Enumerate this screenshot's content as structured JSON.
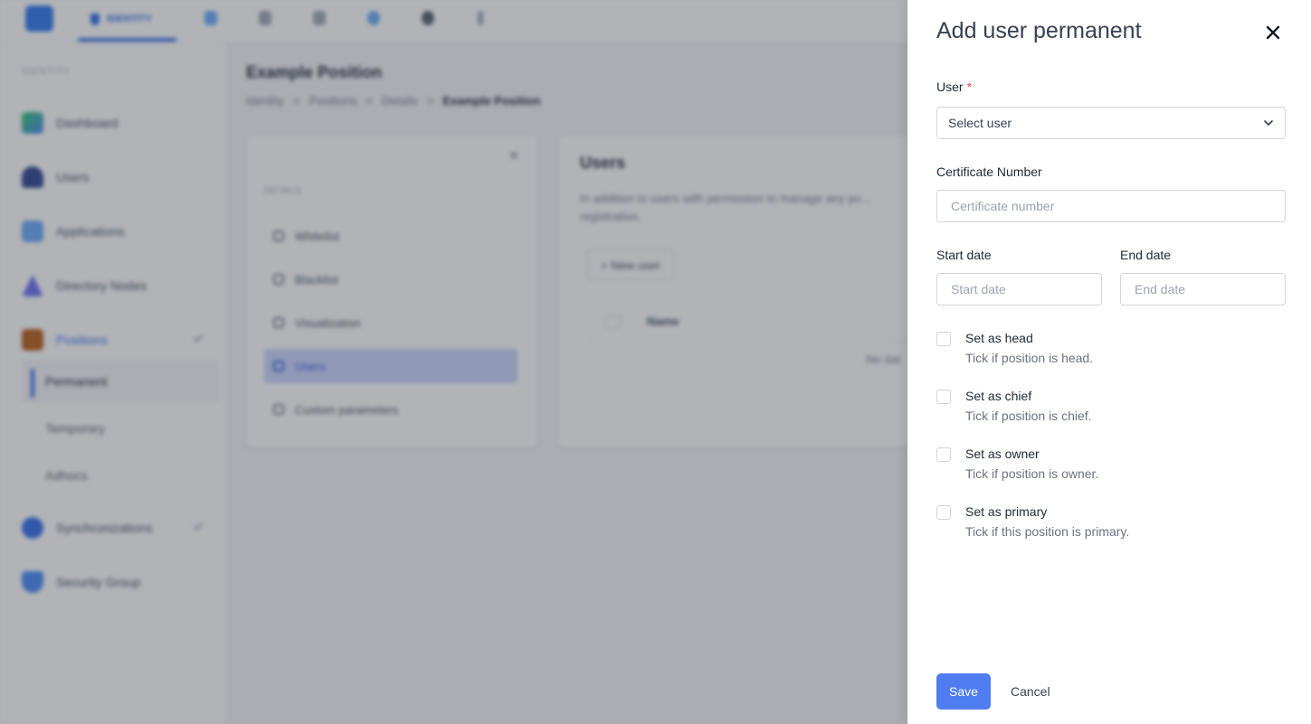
{
  "background": {
    "topbar": {
      "active_tab": "IDENTITY"
    },
    "sidebar": {
      "section_label": "IDENTITY",
      "items": [
        {
          "label": "Dashboard"
        },
        {
          "label": "Users"
        },
        {
          "label": "Applications"
        },
        {
          "label": "Directory Nodes"
        },
        {
          "label": "Positions"
        },
        {
          "label": "Synchronizations"
        },
        {
          "label": "Security Group"
        }
      ],
      "sub_items": [
        "Permanent",
        "Temporary",
        "Adhocs"
      ]
    },
    "page": {
      "title": "Example Position",
      "breadcrumb": [
        "Identity",
        "Positions",
        "Details",
        "Example Position"
      ]
    },
    "left_card": {
      "section_label": "DETAILS",
      "items": [
        "Whitelist",
        "Blacklist",
        "Visualization",
        "Users",
        "Custom parameters"
      ]
    },
    "main_card": {
      "title": "Users",
      "description": "In addition to users with permission to manage any po... registration.",
      "new_button": "+ New user",
      "column_name": "Name",
      "empty_text": "No dat"
    }
  },
  "drawer": {
    "title": "Add user permanent",
    "user": {
      "label": "User",
      "required_mark": "*",
      "selected": "Select user"
    },
    "certificate": {
      "label": "Certificate Number",
      "placeholder": "Certificate number"
    },
    "start_date": {
      "label": "Start date",
      "placeholder": "Start date"
    },
    "end_date": {
      "label": "End date",
      "placeholder": "End date"
    },
    "checks": [
      {
        "title": "Set as head",
        "desc": "Tick if position is head."
      },
      {
        "title": "Set as chief",
        "desc": "Tick if position is chief."
      },
      {
        "title": "Set as owner",
        "desc": "Tick if position is owner."
      },
      {
        "title": "Set as primary",
        "desc": "Tick if this position is primary."
      }
    ],
    "save_label": "Save",
    "cancel_label": "Cancel"
  },
  "colors": {
    "primary": "#4f7cf0",
    "required": "#ef4444",
    "overlay": "#464b54"
  }
}
